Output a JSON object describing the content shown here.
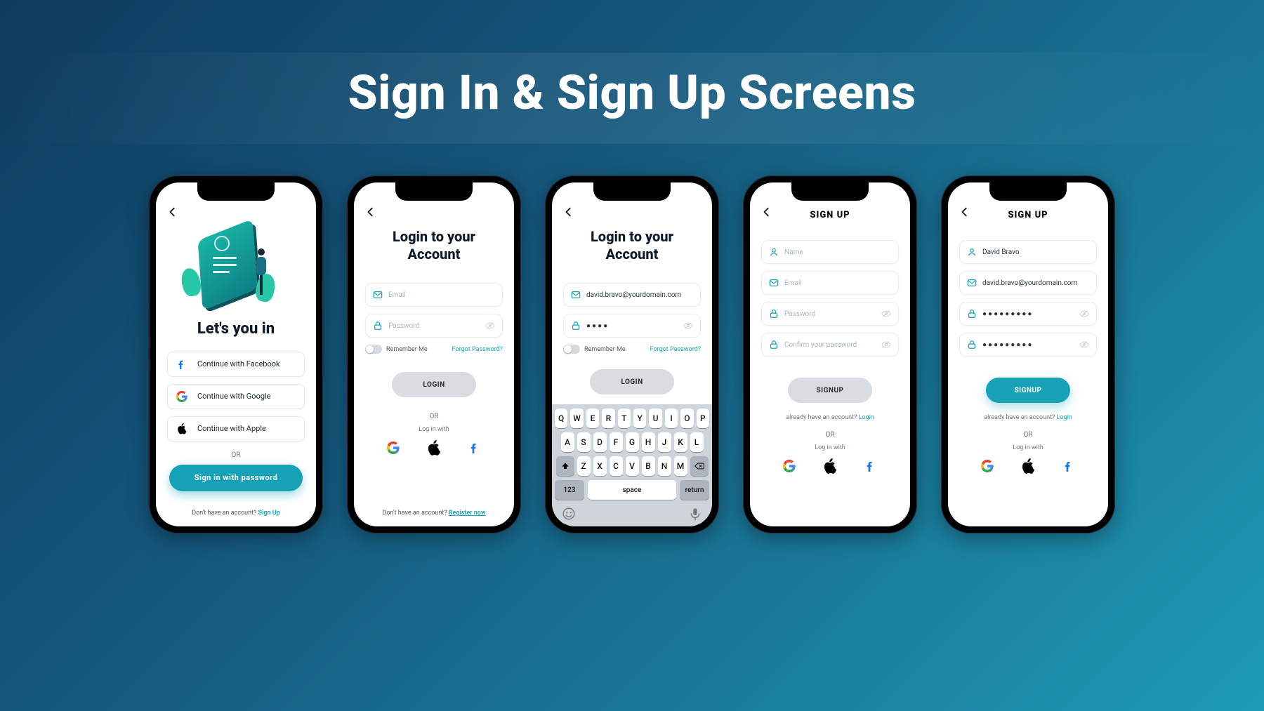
{
  "title": "Sign In & Sign Up Screens",
  "colors": {
    "accent": "#17a2b8"
  },
  "s1": {
    "heading": "Let's you in",
    "facebook": "Continue with Facebook",
    "google": "Continue with Google",
    "apple": "Continue with Apple",
    "or": "OR",
    "signin_pw": "Sign in with password",
    "noacct": "Don't have an account? ",
    "signup": "Sign Up"
  },
  "s2": {
    "heading_l1": "Login to your",
    "heading_l2": "Account",
    "email_ph": "Email",
    "password_ph": "Password",
    "remember": "Remember Me",
    "forgot": "Forgot Password?",
    "login_btn": "LOGIN",
    "or": "OR",
    "login_with": "Log in with",
    "noacct": "Don't have an account? ",
    "register": "Register now"
  },
  "s3": {
    "heading_l1": "Login to your",
    "heading_l2": "Account",
    "email_val": "david.bravo@yourdomain.com",
    "password_val": "●●●●",
    "remember": "Remember Me",
    "forgot": "Forgot Password?",
    "login_btn": "LOGIN",
    "kbd": {
      "r1": [
        "Q",
        "W",
        "E",
        "R",
        "T",
        "Y",
        "U",
        "I",
        "O",
        "P"
      ],
      "r2": [
        "A",
        "S",
        "D",
        "F",
        "G",
        "H",
        "J",
        "K",
        "L"
      ],
      "r3": [
        "Z",
        "X",
        "C",
        "V",
        "B",
        "N",
        "M"
      ],
      "num": "123",
      "space": "space",
      "return": "return"
    }
  },
  "s4": {
    "title": "SIGN UP",
    "name_ph": "Name",
    "email_ph": "Email",
    "password_ph": "Password",
    "confirm_ph": "Confirm your password",
    "signup_btn": "SIGNUP",
    "already": "already have an account? ",
    "login": "Login",
    "or": "OR",
    "login_with": "Log in with"
  },
  "s5": {
    "title": "SIGN UP",
    "name_val": "David Bravo",
    "email_val": "david.bravo@yourdomain.com",
    "password_val": "●●●●●●●●●",
    "confirm_val": "●●●●●●●●●",
    "signup_btn": "SIGNUP",
    "already": "already have an account? ",
    "login": "Login",
    "or": "OR",
    "login_with": "Log in with"
  }
}
